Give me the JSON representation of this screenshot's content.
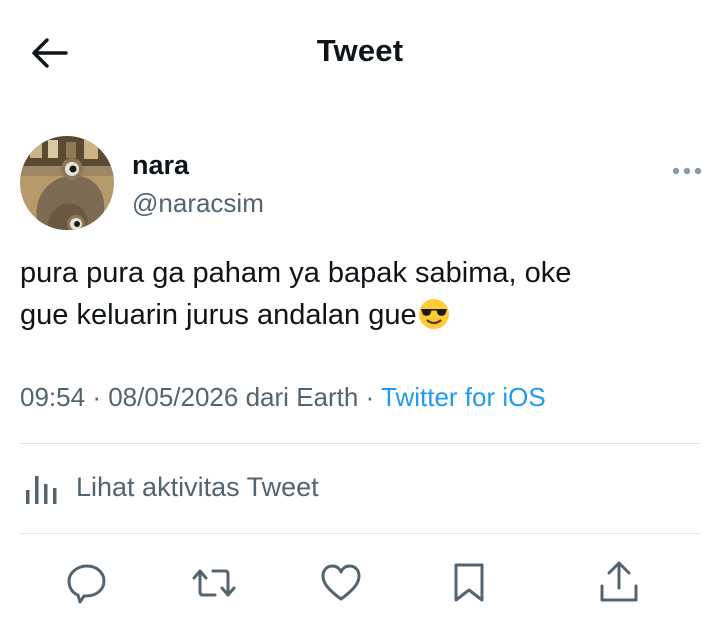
{
  "header": {
    "title": "Tweet",
    "back_icon": "arrow-left-icon"
  },
  "tweet": {
    "author_name": "nara",
    "author_handle": "@naracsim",
    "text_line1": "pura pura ga paham ya bapak sabima, oke",
    "text_line2": "gue keluarin jurus andalan gue",
    "emoji": "😎",
    "time": "09:54",
    "date": "08/05/2026",
    "location_prefix": "dari",
    "location": "Earth",
    "separator": "·",
    "source": "Twitter for iOS"
  },
  "activity": {
    "label": "Lihat aktivitas Tweet",
    "icon": "analytics-bars-icon"
  },
  "actions": [
    {
      "name": "reply",
      "icon": "reply-icon"
    },
    {
      "name": "retweet",
      "icon": "retweet-icon"
    },
    {
      "name": "like",
      "icon": "like-icon"
    },
    {
      "name": "bookmark",
      "icon": "bookmark-icon"
    },
    {
      "name": "share",
      "icon": "share-icon"
    }
  ],
  "colors": {
    "text": "#0f1419",
    "secondary": "#536471",
    "link": "#1d9bf0",
    "divider": "#e1e6ea"
  }
}
